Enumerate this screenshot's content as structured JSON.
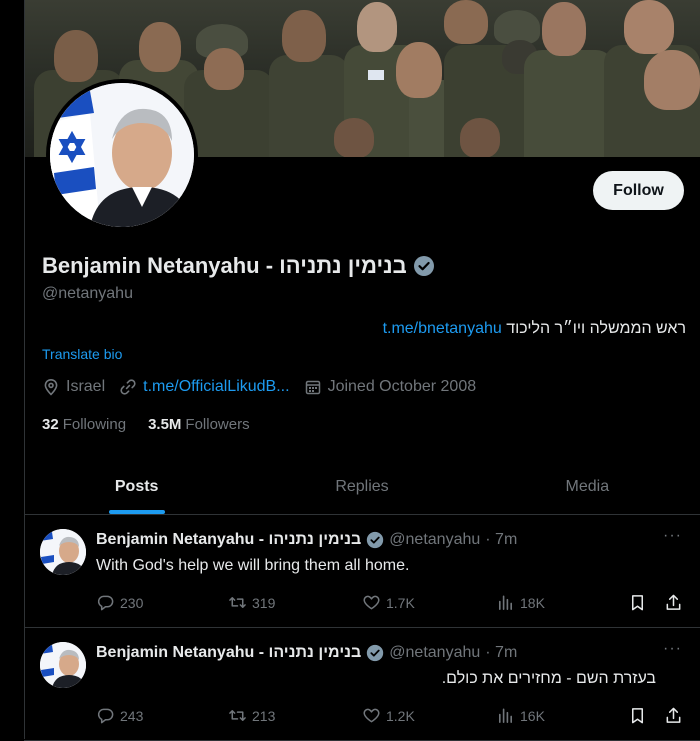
{
  "profile": {
    "display_name": "Benjamin Netanyahu - בנימין נתניהו",
    "handle": "@netanyahu",
    "bio_text": "ראש הממשלה ויו״ר הליכוד",
    "bio_link": "t.me/bnetanyahu",
    "translate_label": "Translate bio",
    "location": "Israel",
    "website": "t.me/OfficialLikudB...",
    "joined": "Joined October 2008",
    "following_count": "32",
    "following_label": "Following",
    "followers_count": "3.5M",
    "followers_label": "Followers",
    "follow_button": "Follow"
  },
  "tabs": [
    {
      "label": "Posts",
      "active": true
    },
    {
      "label": "Replies",
      "active": false
    },
    {
      "label": "Media",
      "active": false
    }
  ],
  "posts": [
    {
      "name": "Benjamin Netanyahu - בנימין נתניהו",
      "handle": "@netanyahu",
      "time": "· 7m",
      "text": "With God's help we will bring them all home.",
      "replies": "230",
      "reposts": "319",
      "likes": "1.7K",
      "views": "18K"
    },
    {
      "name": "Benjamin Netanyahu - בנימין נתניהו",
      "handle": "@netanyahu",
      "time": "· 7m",
      "text": "בעזרת השם - מחזירים את כולם.",
      "replies": "243",
      "reposts": "213",
      "likes": "1.2K",
      "views": "16K"
    }
  ],
  "colors": {
    "accent": "#1d9bf0",
    "background": "#000000",
    "text_primary": "#e7e9ea",
    "text_secondary": "#71767b",
    "border": "#2f3336"
  },
  "icons": {
    "verified": "verified-badge-icon",
    "location": "location-pin-icon",
    "link": "link-icon",
    "calendar": "calendar-icon",
    "reply": "reply-icon",
    "repost": "repost-icon",
    "like": "heart-icon",
    "views": "views-icon",
    "bookmark": "bookmark-icon",
    "share": "share-icon",
    "more": "more-icon"
  }
}
